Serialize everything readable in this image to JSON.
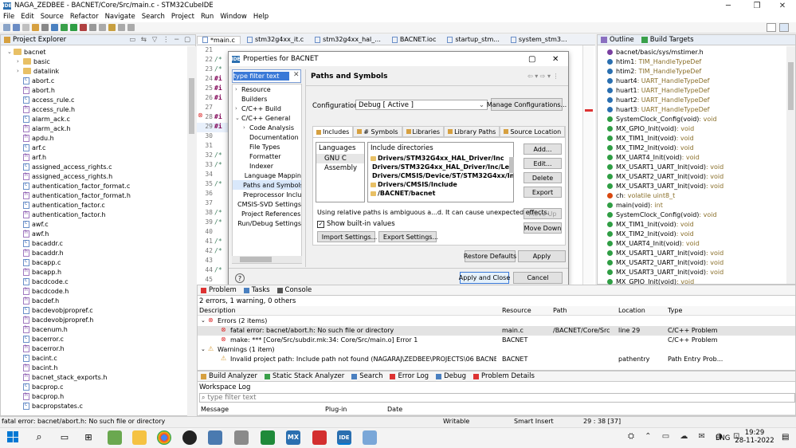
{
  "window": {
    "title": "NAGA_ZEDBEE - BACNET/Core/Src/main.c - STM32CubeIDE"
  },
  "menu": [
    "File",
    "Edit",
    "Source",
    "Refactor",
    "Navigate",
    "Search",
    "Project",
    "Run",
    "Window",
    "Help"
  ],
  "project_explorer": {
    "title": "Project Explorer",
    "root": "bacnet",
    "items": [
      {
        "type": "folder",
        "label": "basic"
      },
      {
        "type": "folder",
        "label": "datalink"
      },
      {
        "type": "c",
        "label": "abort.c"
      },
      {
        "type": "h",
        "label": "abort.h"
      },
      {
        "type": "c",
        "label": "access_rule.c"
      },
      {
        "type": "h",
        "label": "access_rule.h"
      },
      {
        "type": "c",
        "label": "alarm_ack.c"
      },
      {
        "type": "h",
        "label": "alarm_ack.h"
      },
      {
        "type": "h",
        "label": "apdu.h"
      },
      {
        "type": "c",
        "label": "arf.c"
      },
      {
        "type": "h",
        "label": "arf.h"
      },
      {
        "type": "c",
        "label": "assigned_access_rights.c"
      },
      {
        "type": "h",
        "label": "assigned_access_rights.h"
      },
      {
        "type": "c",
        "label": "authentication_factor_format.c"
      },
      {
        "type": "h",
        "label": "authentication_factor_format.h"
      },
      {
        "type": "c",
        "label": "authentication_factor.c"
      },
      {
        "type": "h",
        "label": "authentication_factor.h"
      },
      {
        "type": "c",
        "label": "awf.c"
      },
      {
        "type": "h",
        "label": "awf.h"
      },
      {
        "type": "c",
        "label": "bacaddr.c"
      },
      {
        "type": "h",
        "label": "bacaddr.h"
      },
      {
        "type": "c",
        "label": "bacapp.c"
      },
      {
        "type": "h",
        "label": "bacapp.h"
      },
      {
        "type": "c",
        "label": "bacdcode.c"
      },
      {
        "type": "h",
        "label": "bacdcode.h"
      },
      {
        "type": "h",
        "label": "bacdef.h"
      },
      {
        "type": "c",
        "label": "bacdevobjpropref.c"
      },
      {
        "type": "h",
        "label": "bacdevobjpropref.h"
      },
      {
        "type": "h",
        "label": "bacenum.h"
      },
      {
        "type": "c",
        "label": "bacerror.c"
      },
      {
        "type": "h",
        "label": "bacerror.h"
      },
      {
        "type": "c",
        "label": "bacint.c"
      },
      {
        "type": "h",
        "label": "bacint.h"
      },
      {
        "type": "h",
        "label": "bacnet_stack_exports.h"
      },
      {
        "type": "c",
        "label": "bacprop.c"
      },
      {
        "type": "h",
        "label": "bacprop.h"
      },
      {
        "type": "c",
        "label": "bacpropstates.c"
      }
    ]
  },
  "editor": {
    "tabs": [
      "*main.c",
      "stm32g4xx_it.c",
      "stm32g4xx_hal_...",
      "BACNET.ioc",
      "startup_stm...",
      "system_stm3..."
    ],
    "lines": [
      {
        "n": "21",
        "t": ""
      },
      {
        "n": "22",
        "t": "/*"
      },
      {
        "n": "23",
        "t": "/*"
      },
      {
        "n": "24",
        "t": "#i"
      },
      {
        "n": "25",
        "t": "#i"
      },
      {
        "n": "26",
        "t": "#i"
      },
      {
        "n": "27",
        "t": ""
      },
      {
        "n": "28",
        "t": "#i"
      },
      {
        "n": "29",
        "t": "#i"
      },
      {
        "n": "30",
        "t": ""
      },
      {
        "n": "31",
        "t": ""
      },
      {
        "n": "32",
        "t": "/*"
      },
      {
        "n": "33",
        "t": "/*"
      },
      {
        "n": "34",
        "t": ""
      },
      {
        "n": "35",
        "t": "/*"
      },
      {
        "n": "36",
        "t": ""
      },
      {
        "n": "37",
        "t": ""
      },
      {
        "n": "38",
        "t": "/*"
      },
      {
        "n": "39",
        "t": "/*"
      },
      {
        "n": "40",
        "t": ""
      },
      {
        "n": "41",
        "t": "/*"
      },
      {
        "n": "42",
        "t": "/*"
      },
      {
        "n": "43",
        "t": ""
      },
      {
        "n": "44",
        "t": "/*"
      },
      {
        "n": "45",
        "t": ""
      },
      {
        "n": "46",
        "t": "/*"
      },
      {
        "n": "47",
        "t": "/*"
      }
    ]
  },
  "dialog": {
    "title": "Properties for BACNET",
    "filter_placeholder": "type filter text",
    "nav": [
      {
        "label": "Resource",
        "indent": 0,
        "arrow": "›"
      },
      {
        "label": "Builders",
        "indent": 0,
        "arrow": ""
      },
      {
        "label": "C/C++ Build",
        "indent": 0,
        "arrow": "›"
      },
      {
        "label": "C/C++ General",
        "indent": 0,
        "arrow": "⌄"
      },
      {
        "label": "Code Analysis",
        "indent": 1,
        "arrow": "›"
      },
      {
        "label": "Documentation",
        "indent": 1,
        "arrow": ""
      },
      {
        "label": "File Types",
        "indent": 1,
        "arrow": ""
      },
      {
        "label": "Formatter",
        "indent": 1,
        "arrow": ""
      },
      {
        "label": "Indexer",
        "indent": 1,
        "arrow": ""
      },
      {
        "label": "Language Mappin",
        "indent": 1,
        "arrow": ""
      },
      {
        "label": "Paths and Symbols",
        "indent": 1,
        "arrow": "",
        "selected": true
      },
      {
        "label": "Preprocessor Inclu",
        "indent": 1,
        "arrow": ""
      },
      {
        "label": "CMSIS-SVD Settings",
        "indent": 0,
        "arrow": ""
      },
      {
        "label": "Project References",
        "indent": 0,
        "arrow": ""
      },
      {
        "label": "Run/Debug Settings",
        "indent": 0,
        "arrow": ""
      }
    ],
    "page_title": "Paths and Symbols",
    "config_label": "Configuration:",
    "config_value": "Debug  [ Active ]",
    "manage_btn": "Manage Configurations...",
    "tabs": [
      "Includes",
      "# Symbols",
      "Libraries",
      "Library Paths",
      "Source Location",
      "Re"
    ],
    "languages_header": "Languages",
    "languages": [
      "GNU C",
      "Assembly"
    ],
    "include_header": "Include directories",
    "includes": [
      "Drivers/STM32G4xx_HAL_Driver/Inc",
      "Drivers/STM32G4xx_HAL_Driver/Inc/Legacy",
      "Drivers/CMSIS/Device/ST/STM32G4xx/Inc...",
      "Drivers/CMSIS/Include",
      "/BACNET/bacnet"
    ],
    "side_buttons": [
      "Add...",
      "Edit...",
      "Delete",
      "Export",
      "Move Up",
      "Move Down"
    ],
    "relative_note": "Using relative paths is ambiguous a...d. It can cause unexpected effects.",
    "show_builtin": "Show built-in values",
    "import_btn": "Import Settings...",
    "export_btn": "Export Settings...",
    "restore_btn": "Restore Defaults",
    "apply_btn": "Apply",
    "apply_close_btn": "Apply and Close",
    "cancel_btn": "Cancel",
    "help_glyph": "?"
  },
  "outline": {
    "title": "Outline",
    "title2": "Build Targets",
    "items": [
      {
        "label": "bacnet/basic/sys/mstimer.h",
        "type": "",
        "color": "#7a40a0"
      },
      {
        "label": "htim1",
        "type": " : TIM_HandleTypeDef",
        "color": "#2a6fb0"
      },
      {
        "label": "htim2",
        "type": " : TIM_HandleTypeDef",
        "color": "#2a6fb0"
      },
      {
        "label": "huart4",
        "type": " : UART_HandleTypeDef",
        "color": "#2a6fb0"
      },
      {
        "label": "huart1",
        "type": " : UART_HandleTypeDef",
        "color": "#2a6fb0"
      },
      {
        "label": "huart2",
        "type": " : UART_HandleTypeDef",
        "color": "#2a6fb0"
      },
      {
        "label": "huart3",
        "type": " : UART_HandleTypeDef",
        "color": "#2a6fb0"
      },
      {
        "label": "SystemClock_Config(void)",
        "type": " : void",
        "color": "#2f9e44"
      },
      {
        "label": "MX_GPIO_Init(void)",
        "type": " : void",
        "color": "#2f9e44"
      },
      {
        "label": "MX_TIM1_Init(void)",
        "type": " : void",
        "color": "#2f9e44"
      },
      {
        "label": "MX_TIM2_Init(void)",
        "type": " : void",
        "color": "#2f9e44"
      },
      {
        "label": "MX_UART4_Init(void)",
        "type": " : void",
        "color": "#2f9e44"
      },
      {
        "label": "MX_USART1_UART_Init(void)",
        "type": " : void",
        "color": "#2f9e44"
      },
      {
        "label": "MX_USART2_UART_Init(void)",
        "type": " : void",
        "color": "#2f9e44"
      },
      {
        "label": "MX_USART3_UART_Init(void)",
        "type": " : void",
        "color": "#2f9e44"
      },
      {
        "label": "ch",
        "type": " : volatile uint8_t",
        "color": "#d9480f"
      },
      {
        "label": "main(void)",
        "type": " : int",
        "color": "#2f9e44"
      },
      {
        "label": "SystemClock_Config(void)",
        "type": " : void",
        "color": "#2f9e44"
      },
      {
        "label": "MX_TIM1_Init(void)",
        "type": " : void",
        "color": "#2f9e44"
      },
      {
        "label": "MX_TIM2_Init(void)",
        "type": " : void",
        "color": "#2f9e44"
      },
      {
        "label": "MX_UART4_Init(void)",
        "type": " : void",
        "color": "#2f9e44"
      },
      {
        "label": "MX_USART1_UART_Init(void)",
        "type": " : void",
        "color": "#2f9e44"
      },
      {
        "label": "MX_USART2_UART_Init(void)",
        "type": " : void",
        "color": "#2f9e44"
      },
      {
        "label": "MX_USART3_UART_Init(void)",
        "type": " : void",
        "color": "#2f9e44"
      },
      {
        "label": "MX_GPIO_Init(void)",
        "type": " : void",
        "color": "#2f9e44"
      }
    ]
  },
  "problems": {
    "tabs": [
      "Problem",
      "Tasks",
      "Console"
    ],
    "summary": "2 errors, 1 warning, 0 others",
    "headers": [
      "Description",
      "Resource",
      "Path",
      "Location",
      "Type"
    ],
    "rows": [
      {
        "kind": "group-error",
        "desc": "Errors (2 items)",
        "res": "",
        "path": "",
        "loc": "",
        "type": ""
      },
      {
        "kind": "error",
        "desc": "fatal error: bacnet/abort.h: No such file or directory",
        "res": "main.c",
        "path": "/BACNET/Core/Src",
        "loc": "line 29",
        "type": "C/C++ Problem",
        "selected": true
      },
      {
        "kind": "error",
        "desc": "make: *** [Core/Src/subdir.mk:34: Core/Src/main.o] Error 1",
        "res": "BACNET",
        "path": "",
        "loc": "",
        "type": "C/C++ Problem"
      },
      {
        "kind": "group-warn",
        "desc": "Warnings (1 item)",
        "res": "",
        "path": "",
        "loc": "",
        "type": ""
      },
      {
        "kind": "warn",
        "desc": "Invalid project path: Include path not found (NAGARAJ\\ZEDBEE\\PROJECTS\\06 BACNET\\CODE\\BACNI",
        "res": "BACNET",
        "path": "",
        "loc": "pathentry",
        "type": "Path Entry Prob..."
      }
    ]
  },
  "bottom": {
    "tabs": [
      "Build Analyzer",
      "Static Stack Analyzer",
      "Search",
      "Error Log",
      "Debug",
      "Problem Details"
    ],
    "log_title": "Workspace Log",
    "filter_placeholder": "type filter text",
    "cols": [
      "Message",
      "Plug-in",
      "Date"
    ]
  },
  "statusbar": {
    "left": "fatal error: bacnet/abort.h: No such file or directory",
    "writable": "Writable",
    "insert": "Smart Insert",
    "pos": "29 : 38 [37]"
  },
  "taskbar": {
    "lang": "ENG",
    "time": "19:29",
    "date": "28-11-2022",
    "mx_label": "MX",
    "ide_label": "IDE"
  }
}
